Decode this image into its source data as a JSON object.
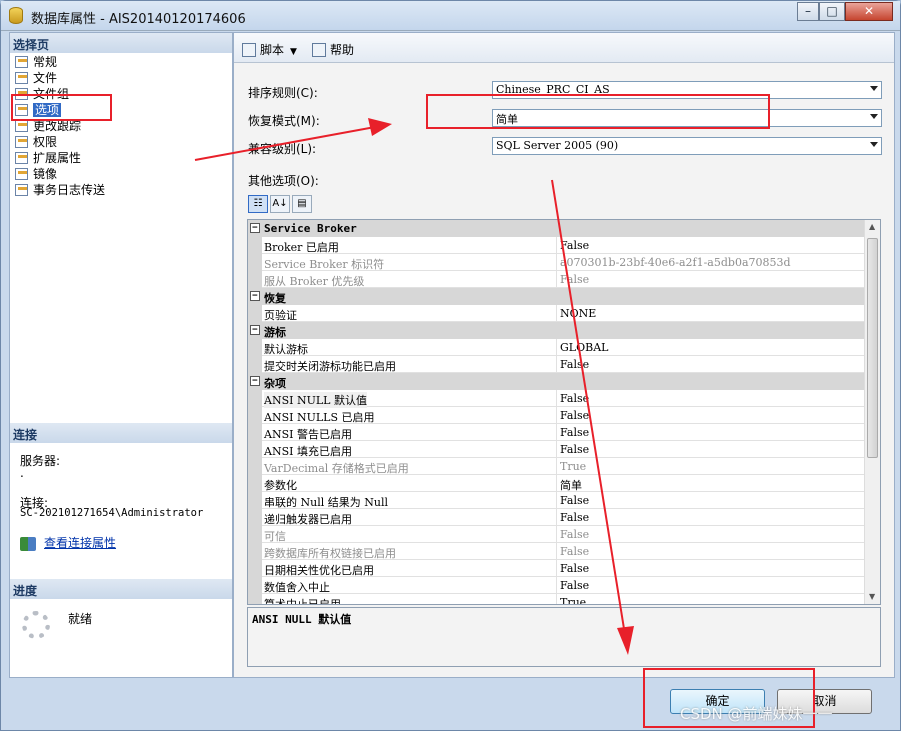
{
  "window": {
    "title": "数据库属性 - AIS20140120174606",
    "bg_titles": [
      "",
      "",
      ""
    ]
  },
  "left": {
    "select_page_header": "选择页",
    "nav": [
      {
        "label": "常规"
      },
      {
        "label": "文件"
      },
      {
        "label": "文件组"
      },
      {
        "label": "选项",
        "selected": true
      },
      {
        "label": "更改跟踪"
      },
      {
        "label": "权限"
      },
      {
        "label": "扩展属性"
      },
      {
        "label": "镜像"
      },
      {
        "label": "事务日志传送"
      }
    ],
    "connection_header": "连接",
    "server_label": "服务器:",
    "server_value": ".",
    "connection_label": "连接:",
    "connection_value": "SC-202101271654\\Administrator",
    "view_link": "查看连接属性",
    "progress_header": "进度",
    "progress_status": "就绪"
  },
  "toolbar": {
    "script": "脚本",
    "help": "帮助"
  },
  "form": {
    "collation_label": "排序规则(C):",
    "collation_value": "Chinese_PRC_CI_AS",
    "recovery_label": "恢复模式(M):",
    "recovery_value": "简单",
    "compat_label": "兼容级别(L):",
    "compat_value": "SQL Server 2005 (90)",
    "other_label": "其他选项(O):"
  },
  "grid": {
    "rows": [
      {
        "type": "cat",
        "name": "Service Broker"
      },
      {
        "type": "prop",
        "name": "Broker 已启用",
        "value": "False"
      },
      {
        "type": "prop",
        "name": "Service Broker 标识符",
        "value": "a070301b-23bf-40e6-a2f1-a5db0a70853d",
        "disabled": true
      },
      {
        "type": "prop",
        "name": "服从 Broker 优先级",
        "value": "False",
        "disabled": true
      },
      {
        "type": "cat",
        "name": "恢复"
      },
      {
        "type": "prop",
        "name": "页验证",
        "value": "NONE"
      },
      {
        "type": "cat",
        "name": "游标"
      },
      {
        "type": "prop",
        "name": "默认游标",
        "value": "GLOBAL"
      },
      {
        "type": "prop",
        "name": "提交时关闭游标功能已启用",
        "value": "False"
      },
      {
        "type": "cat",
        "name": "杂项"
      },
      {
        "type": "prop",
        "name": "ANSI NULL 默认值",
        "value": "False",
        "highlight": true
      },
      {
        "type": "prop",
        "name": "ANSI NULLS 已启用",
        "value": "False"
      },
      {
        "type": "prop",
        "name": "ANSI 警告已启用",
        "value": "False"
      },
      {
        "type": "prop",
        "name": "ANSI 填充已启用",
        "value": "False"
      },
      {
        "type": "prop",
        "name": "VarDecimal 存储格式已启用",
        "value": "True",
        "disabled": true
      },
      {
        "type": "prop",
        "name": "参数化",
        "value": "简单"
      },
      {
        "type": "prop",
        "name": "串联的 Null 结果为 Null",
        "value": "False"
      },
      {
        "type": "prop",
        "name": "递归触发器已启用",
        "value": "False"
      },
      {
        "type": "prop",
        "name": "可信",
        "value": "False",
        "disabled": true
      },
      {
        "type": "prop",
        "name": "跨数据库所有权链接已启用",
        "value": "False",
        "disabled": true
      },
      {
        "type": "prop",
        "name": "日期相关性优化已启用",
        "value": "False"
      },
      {
        "type": "prop",
        "name": "数值舍入中止",
        "value": "False"
      },
      {
        "type": "prop",
        "name": "算术中止已启用",
        "value": "True"
      }
    ],
    "description": "ANSI NULL 默认值"
  },
  "buttons": {
    "ok": "确定",
    "cancel": "取消"
  },
  "watermark": "CSDN @前端妹妹一一",
  "colors": {
    "annotation_red": "#e8202a",
    "selection_blue": "#316ac5"
  }
}
